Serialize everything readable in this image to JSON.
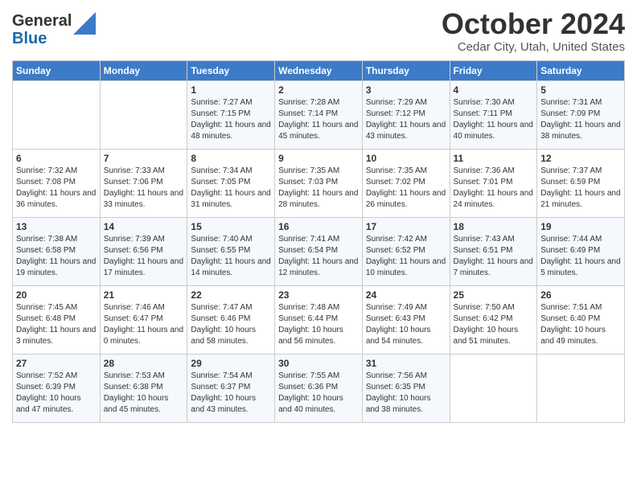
{
  "header": {
    "logo_general": "General",
    "logo_blue": "Blue",
    "month_title": "October 2024",
    "location": "Cedar City, Utah, United States"
  },
  "columns": [
    "Sunday",
    "Monday",
    "Tuesday",
    "Wednesday",
    "Thursday",
    "Friday",
    "Saturday"
  ],
  "weeks": [
    [
      {
        "day": "",
        "sunrise": "",
        "sunset": "",
        "daylight": ""
      },
      {
        "day": "",
        "sunrise": "",
        "sunset": "",
        "daylight": ""
      },
      {
        "day": "1",
        "sunrise": "Sunrise: 7:27 AM",
        "sunset": "Sunset: 7:15 PM",
        "daylight": "Daylight: 11 hours and 48 minutes."
      },
      {
        "day": "2",
        "sunrise": "Sunrise: 7:28 AM",
        "sunset": "Sunset: 7:14 PM",
        "daylight": "Daylight: 11 hours and 45 minutes."
      },
      {
        "day": "3",
        "sunrise": "Sunrise: 7:29 AM",
        "sunset": "Sunset: 7:12 PM",
        "daylight": "Daylight: 11 hours and 43 minutes."
      },
      {
        "day": "4",
        "sunrise": "Sunrise: 7:30 AM",
        "sunset": "Sunset: 7:11 PM",
        "daylight": "Daylight: 11 hours and 40 minutes."
      },
      {
        "day": "5",
        "sunrise": "Sunrise: 7:31 AM",
        "sunset": "Sunset: 7:09 PM",
        "daylight": "Daylight: 11 hours and 38 minutes."
      }
    ],
    [
      {
        "day": "6",
        "sunrise": "Sunrise: 7:32 AM",
        "sunset": "Sunset: 7:08 PM",
        "daylight": "Daylight: 11 hours and 36 minutes."
      },
      {
        "day": "7",
        "sunrise": "Sunrise: 7:33 AM",
        "sunset": "Sunset: 7:06 PM",
        "daylight": "Daylight: 11 hours and 33 minutes."
      },
      {
        "day": "8",
        "sunrise": "Sunrise: 7:34 AM",
        "sunset": "Sunset: 7:05 PM",
        "daylight": "Daylight: 11 hours and 31 minutes."
      },
      {
        "day": "9",
        "sunrise": "Sunrise: 7:35 AM",
        "sunset": "Sunset: 7:03 PM",
        "daylight": "Daylight: 11 hours and 28 minutes."
      },
      {
        "day": "10",
        "sunrise": "Sunrise: 7:35 AM",
        "sunset": "Sunset: 7:02 PM",
        "daylight": "Daylight: 11 hours and 26 minutes."
      },
      {
        "day": "11",
        "sunrise": "Sunrise: 7:36 AM",
        "sunset": "Sunset: 7:01 PM",
        "daylight": "Daylight: 11 hours and 24 minutes."
      },
      {
        "day": "12",
        "sunrise": "Sunrise: 7:37 AM",
        "sunset": "Sunset: 6:59 PM",
        "daylight": "Daylight: 11 hours and 21 minutes."
      }
    ],
    [
      {
        "day": "13",
        "sunrise": "Sunrise: 7:38 AM",
        "sunset": "Sunset: 6:58 PM",
        "daylight": "Daylight: 11 hours and 19 minutes."
      },
      {
        "day": "14",
        "sunrise": "Sunrise: 7:39 AM",
        "sunset": "Sunset: 6:56 PM",
        "daylight": "Daylight: 11 hours and 17 minutes."
      },
      {
        "day": "15",
        "sunrise": "Sunrise: 7:40 AM",
        "sunset": "Sunset: 6:55 PM",
        "daylight": "Daylight: 11 hours and 14 minutes."
      },
      {
        "day": "16",
        "sunrise": "Sunrise: 7:41 AM",
        "sunset": "Sunset: 6:54 PM",
        "daylight": "Daylight: 11 hours and 12 minutes."
      },
      {
        "day": "17",
        "sunrise": "Sunrise: 7:42 AM",
        "sunset": "Sunset: 6:52 PM",
        "daylight": "Daylight: 11 hours and 10 minutes."
      },
      {
        "day": "18",
        "sunrise": "Sunrise: 7:43 AM",
        "sunset": "Sunset: 6:51 PM",
        "daylight": "Daylight: 11 hours and 7 minutes."
      },
      {
        "day": "19",
        "sunrise": "Sunrise: 7:44 AM",
        "sunset": "Sunset: 6:49 PM",
        "daylight": "Daylight: 11 hours and 5 minutes."
      }
    ],
    [
      {
        "day": "20",
        "sunrise": "Sunrise: 7:45 AM",
        "sunset": "Sunset: 6:48 PM",
        "daylight": "Daylight: 11 hours and 3 minutes."
      },
      {
        "day": "21",
        "sunrise": "Sunrise: 7:46 AM",
        "sunset": "Sunset: 6:47 PM",
        "daylight": "Daylight: 11 hours and 0 minutes."
      },
      {
        "day": "22",
        "sunrise": "Sunrise: 7:47 AM",
        "sunset": "Sunset: 6:46 PM",
        "daylight": "Daylight: 10 hours and 58 minutes."
      },
      {
        "day": "23",
        "sunrise": "Sunrise: 7:48 AM",
        "sunset": "Sunset: 6:44 PM",
        "daylight": "Daylight: 10 hours and 56 minutes."
      },
      {
        "day": "24",
        "sunrise": "Sunrise: 7:49 AM",
        "sunset": "Sunset: 6:43 PM",
        "daylight": "Daylight: 10 hours and 54 minutes."
      },
      {
        "day": "25",
        "sunrise": "Sunrise: 7:50 AM",
        "sunset": "Sunset: 6:42 PM",
        "daylight": "Daylight: 10 hours and 51 minutes."
      },
      {
        "day": "26",
        "sunrise": "Sunrise: 7:51 AM",
        "sunset": "Sunset: 6:40 PM",
        "daylight": "Daylight: 10 hours and 49 minutes."
      }
    ],
    [
      {
        "day": "27",
        "sunrise": "Sunrise: 7:52 AM",
        "sunset": "Sunset: 6:39 PM",
        "daylight": "Daylight: 10 hours and 47 minutes."
      },
      {
        "day": "28",
        "sunrise": "Sunrise: 7:53 AM",
        "sunset": "Sunset: 6:38 PM",
        "daylight": "Daylight: 10 hours and 45 minutes."
      },
      {
        "day": "29",
        "sunrise": "Sunrise: 7:54 AM",
        "sunset": "Sunset: 6:37 PM",
        "daylight": "Daylight: 10 hours and 43 minutes."
      },
      {
        "day": "30",
        "sunrise": "Sunrise: 7:55 AM",
        "sunset": "Sunset: 6:36 PM",
        "daylight": "Daylight: 10 hours and 40 minutes."
      },
      {
        "day": "31",
        "sunrise": "Sunrise: 7:56 AM",
        "sunset": "Sunset: 6:35 PM",
        "daylight": "Daylight: 10 hours and 38 minutes."
      },
      {
        "day": "",
        "sunrise": "",
        "sunset": "",
        "daylight": ""
      },
      {
        "day": "",
        "sunrise": "",
        "sunset": "",
        "daylight": ""
      }
    ]
  ]
}
